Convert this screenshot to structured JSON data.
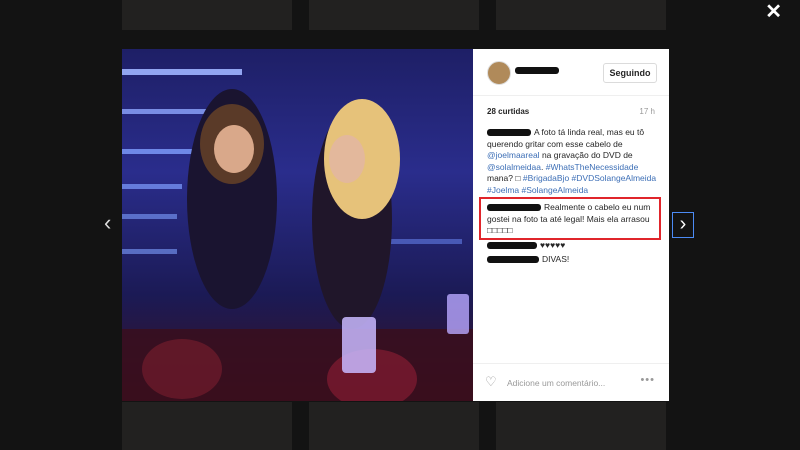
{
  "overlay": {
    "close_label": "✕",
    "prev_label": "‹",
    "next_label": "›"
  },
  "post": {
    "follow_label": "Seguindo",
    "likes": "28 curtidas",
    "time": "17 h",
    "caption_parts": [
      {
        "type": "text",
        "text": "A foto tá linda real, mas eu tô querendo gritar com esse cabelo de "
      },
      {
        "type": "link",
        "text": "@joelmaareal"
      },
      {
        "type": "text",
        "text": " na gravação do DVD de "
      },
      {
        "type": "link",
        "text": "@solalmeidaa"
      },
      {
        "type": "text",
        "text": ". "
      },
      {
        "type": "link",
        "text": "#WhatsTheNecessidade"
      },
      {
        "type": "text",
        "text": " mana? □ "
      },
      {
        "type": "link",
        "text": "#BrigadaBjo"
      },
      {
        "type": "text",
        "text": " "
      },
      {
        "type": "link",
        "text": "#DVDSolangeAlmeida"
      },
      {
        "type": "text",
        "text": " "
      },
      {
        "type": "link",
        "text": "#Joelma"
      },
      {
        "type": "text",
        "text": " "
      },
      {
        "type": "link",
        "text": "#SolangeAlmeida"
      }
    ],
    "comments": [
      {
        "text": "Realmente o cabelo eu num gostei na foto ta até legal! Mais ela arrasou □□□□□"
      },
      {
        "text": "♥♥♥♥♥"
      },
      {
        "text": "DIVAS!"
      }
    ],
    "add_comment_placeholder": "Adicione um comentário...",
    "more_label": "•••"
  },
  "colors": {
    "link": "#3d6fb6",
    "highlight": "#e0252b"
  }
}
